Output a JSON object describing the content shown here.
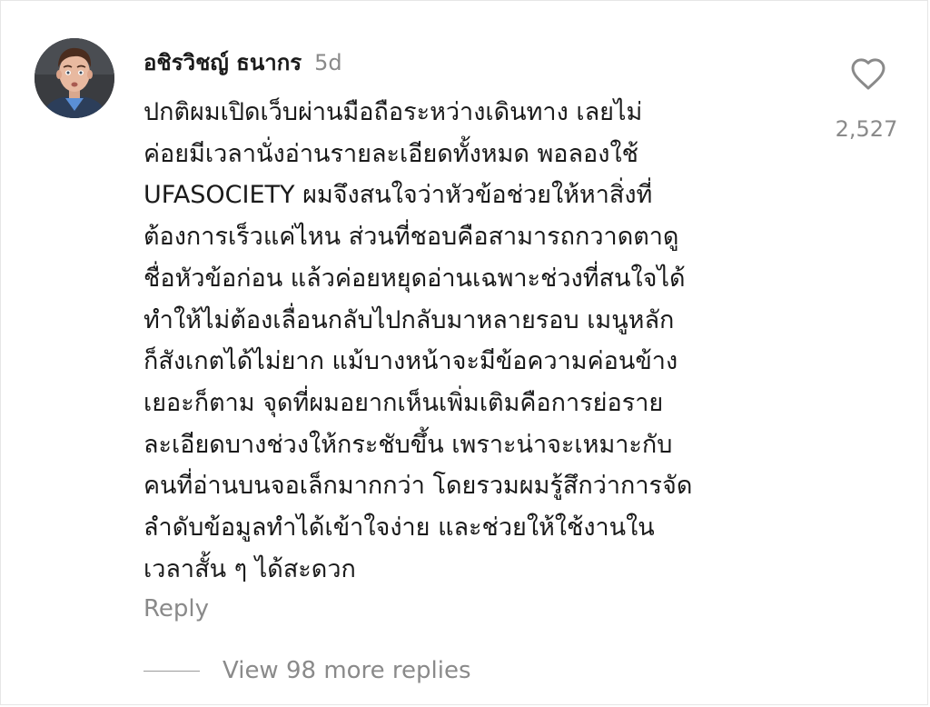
{
  "comment": {
    "avatar": {
      "icon": "user-avatar-photo",
      "colors": {
        "background": "#3a3c40",
        "skin": "#e8b9a0",
        "hair": "#4a2c1e",
        "shirt": "#5a8fd6",
        "jacket": "#2c3e5a"
      }
    },
    "author": "อชิรวิชญ์ ธนากร",
    "time_ago": "5d",
    "text_lines": [
      "ปกติผมเปิดเว็บผ่านมือถือระหว่างเดินทาง เลยไม่",
      "ค่อยมีเวลานั่งอ่านรายละเอียดทั้งหมด พอลองใช้",
      "UFASOCIETY ผมจึงสนใจว่าหัวข้อช่วยให้หาสิ่งที่",
      "ต้องการเร็วแค่ไหน ส่วนที่ชอบคือสามารถกวาดตาดู",
      "ชื่อหัวข้อก่อน แล้วค่อยหยุดอ่านเฉพาะช่วงที่สนใจได้",
      "ทำให้ไม่ต้องเลื่อนกลับไปกลับมาหลายรอบ เมนูหลัก",
      "ก็สังเกตได้ไม่ยาก แม้บางหน้าจะมีข้อความค่อนข้าง",
      "เยอะก็ตาม จุดที่ผมอยากเห็นเพิ่มเติมคือการย่อราย",
      "ละเอียดบางช่วงให้กระชับขึ้น เพราะน่าจะเหมาะกับ",
      "คนที่อ่านบนจอเล็กมากกว่า โดยรวมผมรู้สึกว่าการจัด",
      "ลำดับข้อมูลทำได้เข้าใจง่าย และช่วยให้ใช้งานใน",
      "เวลาสั้น ๆ ได้สะดวก"
    ],
    "like_icon": "heart-outline-icon",
    "like_count": "2,527",
    "reply_label": "Reply",
    "view_replies_label": "View 98 more replies",
    "colors": {
      "text": "#1a1a1a",
      "muted": "#8a8a8a",
      "background": "#ffffff"
    }
  }
}
